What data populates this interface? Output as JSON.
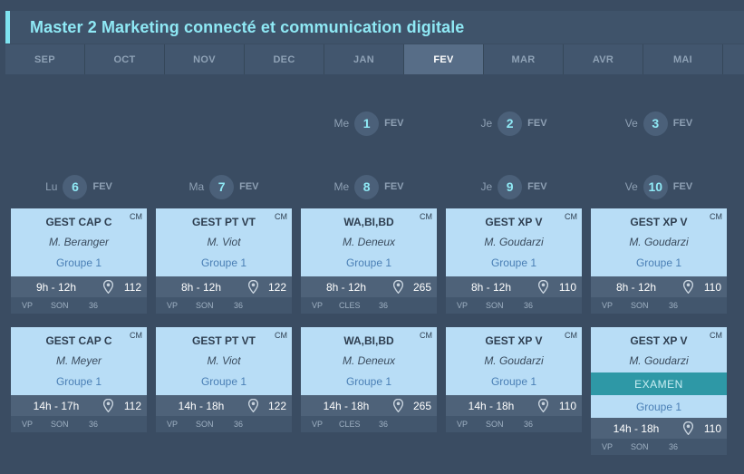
{
  "title": "Master 2 Marketing connecté et communication digitale",
  "months": [
    "SEP",
    "OCT",
    "NOV",
    "DEC",
    "JAN",
    "FEV",
    "MAR",
    "AVR",
    "MAI"
  ],
  "active_month": "FEV",
  "week1": [
    {
      "dow": "Me",
      "num": "1",
      "mon": "FEV"
    },
    {
      "dow": "Je",
      "num": "2",
      "mon": "FEV"
    },
    {
      "dow": "Ve",
      "num": "3",
      "mon": "FEV"
    }
  ],
  "week2": [
    {
      "dow": "Lu",
      "num": "6",
      "mon": "FEV"
    },
    {
      "dow": "Ma",
      "num": "7",
      "mon": "FEV"
    },
    {
      "dow": "Me",
      "num": "8",
      "mon": "FEV"
    },
    {
      "dow": "Je",
      "num": "9",
      "mon": "FEV"
    },
    {
      "dow": "Ve",
      "num": "10",
      "mon": "FEV"
    }
  ],
  "sessions": [
    [
      {
        "code": "GEST CAP C",
        "type": "CM",
        "teacher": "M. Beranger",
        "group": "Groupe 1",
        "hours": "9h - 12h",
        "room": "112",
        "tags": [
          "VP",
          "SON",
          "36"
        ]
      },
      {
        "code": "GEST CAP C",
        "type": "CM",
        "teacher": "M. Meyer",
        "group": "Groupe 1",
        "hours": "14h - 17h",
        "room": "112",
        "tags": [
          "VP",
          "SON",
          "36"
        ]
      }
    ],
    [
      {
        "code": "GEST PT VT",
        "type": "CM",
        "teacher": "M. Viot",
        "group": "Groupe 1",
        "hours": "8h - 12h",
        "room": "122",
        "tags": [
          "VP",
          "SON",
          "36"
        ]
      },
      {
        "code": "GEST PT VT",
        "type": "CM",
        "teacher": "M. Viot",
        "group": "Groupe 1",
        "hours": "14h - 18h",
        "room": "122",
        "tags": [
          "VP",
          "SON",
          "36"
        ]
      }
    ],
    [
      {
        "code": "WA,BI,BD",
        "type": "CM",
        "teacher": "M. Deneux",
        "group": "Groupe 1",
        "hours": "8h - 12h",
        "room": "265",
        "tags": [
          "VP",
          "CLES",
          "36"
        ]
      },
      {
        "code": "WA,BI,BD",
        "type": "CM",
        "teacher": "M. Deneux",
        "group": "Groupe 1",
        "hours": "14h - 18h",
        "room": "265",
        "tags": [
          "VP",
          "CLES",
          "36"
        ]
      }
    ],
    [
      {
        "code": "GEST XP V",
        "type": "CM",
        "teacher": "M. Goudarzi",
        "group": "Groupe 1",
        "hours": "8h - 12h",
        "room": "110",
        "tags": [
          "VP",
          "SON",
          "36"
        ]
      },
      {
        "code": "GEST XP V",
        "type": "CM",
        "teacher": "M. Goudarzi",
        "group": "Groupe 1",
        "hours": "14h - 18h",
        "room": "110",
        "tags": [
          "VP",
          "SON",
          "36"
        ]
      }
    ],
    [
      {
        "code": "GEST XP V",
        "type": "CM",
        "teacher": "M. Goudarzi",
        "group": "Groupe 1",
        "hours": "8h - 12h",
        "room": "110",
        "tags": [
          "VP",
          "SON",
          "36"
        ]
      },
      {
        "code": "GEST XP V",
        "type": "CM",
        "teacher": "M. Goudarzi",
        "exam": "EXAMEN",
        "group": "Groupe 1",
        "hours": "14h - 18h",
        "room": "110",
        "tags": [
          "VP",
          "SON",
          "36"
        ]
      }
    ]
  ]
}
